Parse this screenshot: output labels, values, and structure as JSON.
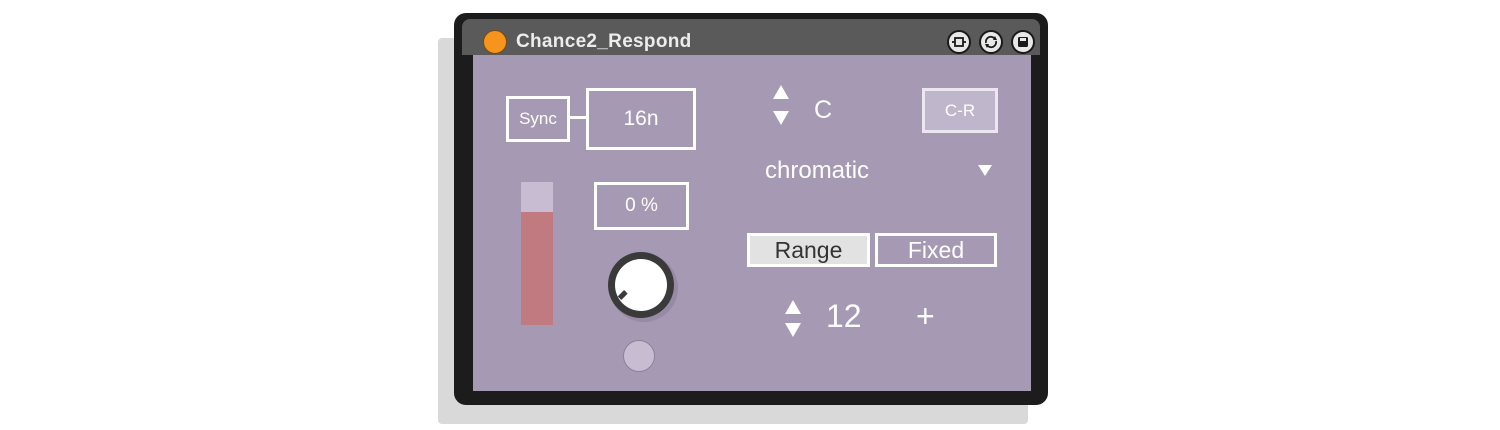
{
  "window": {
    "title": "Chance2_Respond",
    "icons": [
      "pin-icon",
      "refresh-icon",
      "save-icon"
    ]
  },
  "timing": {
    "sync_label": "Sync",
    "rate_value": "16n",
    "percent_value": "0 %"
  },
  "meter": {
    "level_fraction": 0.79
  },
  "scale": {
    "root_note": "C",
    "mode": "chromatic",
    "cr_button": "C-R"
  },
  "range_mode": {
    "options": [
      "Range",
      "Fixed"
    ],
    "selected": "Range"
  },
  "range_amount": {
    "value": "12",
    "plus_label": "+"
  },
  "colors": {
    "panel_bg": "#a699b3",
    "meter_fill": "#c17b80",
    "meter_empty": "#c8bcd3",
    "title_dot": "#f7941d"
  }
}
